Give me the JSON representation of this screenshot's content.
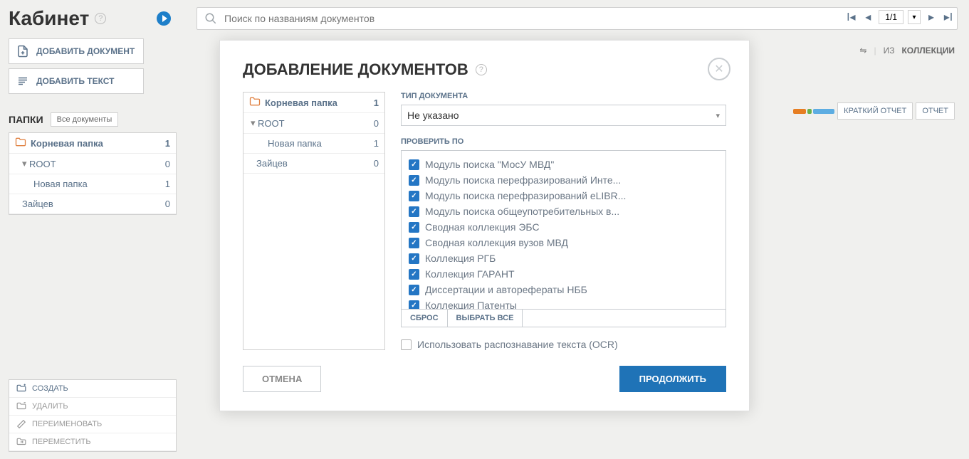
{
  "page_title": "Кабинет",
  "add_document_button": "ДОБАВИТЬ ДОКУМЕНТ",
  "add_text_button": "ДОБАВИТЬ ТЕКСТ",
  "folders_section_title": "ПАПКИ",
  "all_documents_button": "Все документы",
  "sidebar_folders": [
    {
      "name": "Корневая папка",
      "count": "1",
      "root": true
    },
    {
      "name": "ROOT",
      "count": "0",
      "arrow": true
    },
    {
      "name": "Новая папка",
      "count": "1",
      "indent": 2
    },
    {
      "name": "Зайцев",
      "count": "0",
      "indent": 1
    }
  ],
  "sidebar_actions": {
    "create": "СОЗДАТЬ",
    "delete": "УДАЛИТЬ",
    "rename": "ПЕРЕИМЕНОВАТЬ",
    "move": "ПЕРЕМЕСТИТЬ"
  },
  "search_placeholder": "Поиск по названиям документов",
  "pagination": {
    "page": "1/1"
  },
  "top_tools": {
    "from": "ИЗ",
    "collections": "КОЛЛЕКЦИИ"
  },
  "report_buttons": {
    "short": "КРАТКИЙ ОТЧЕТ",
    "full": "ОТЧЕТ"
  },
  "modal": {
    "title": "ДОБАВЛЕНИЕ ДОКУМЕНТОВ",
    "folders": [
      {
        "name": "Корневая папка",
        "count": "1",
        "root": true
      },
      {
        "name": "ROOT",
        "count": "0",
        "arrow": true
      },
      {
        "name": "Новая папка",
        "count": "1",
        "indent": 2
      },
      {
        "name": "Зайцев",
        "count": "0",
        "indent": 1
      }
    ],
    "doc_type_label": "ТИП ДОКУМЕНТА",
    "doc_type_value": "Не указано",
    "check_by_label": "ПРОВЕРИТЬ ПО",
    "check_items": [
      "Модуль поиска \"МосУ МВД\"",
      "Модуль поиска перефразирований Инте...",
      "Модуль поиска перефразирований eLIBR...",
      "Модуль поиска общеупотребительных в...",
      "Сводная коллекция ЭБС",
      "Сводная коллекция вузов МВД",
      "Коллекция РГБ",
      "Коллекция ГАРАНТ",
      "Диссертации и авторефераты НББ",
      "Коллекция Патенты"
    ],
    "reset": "СБРОС",
    "select_all": "ВЫБРАТЬ ВСЕ",
    "ocr_label": "Использовать распознавание текста (OCR)",
    "cancel": "ОТМЕНА",
    "continue": "ПРОДОЛЖИТЬ"
  }
}
